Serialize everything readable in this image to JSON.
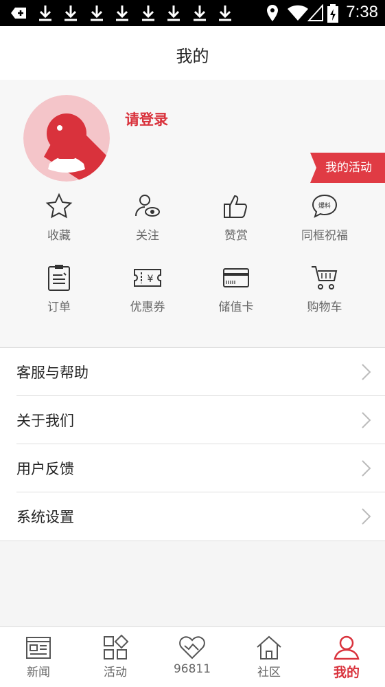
{
  "status_bar": {
    "time": "7:38",
    "icons": [
      "notification-plus-icon",
      "download-icon",
      "download-icon",
      "download-icon",
      "download-icon",
      "download-icon",
      "download-icon",
      "download-icon",
      "download-icon",
      "location-icon",
      "wifi-icon",
      "signal-icon",
      "battery-charging-icon"
    ]
  },
  "header": {
    "title": "我的"
  },
  "profile": {
    "login_label": "请登录",
    "activity_tag": "我的活动"
  },
  "shortcuts": [
    {
      "label": "收藏",
      "icon": "star-icon"
    },
    {
      "label": "关注",
      "icon": "follow-user-icon"
    },
    {
      "label": "赞赏",
      "icon": "thumbs-up-icon"
    },
    {
      "label": "同框祝福",
      "icon": "chat-bubble-icon",
      "badge": "爆料"
    },
    {
      "label": "订单",
      "icon": "clipboard-icon"
    },
    {
      "label": "优惠券",
      "icon": "coupon-icon",
      "badge": "¥"
    },
    {
      "label": "储值卡",
      "icon": "card-icon"
    },
    {
      "label": "购物车",
      "icon": "cart-icon"
    }
  ],
  "menu": [
    {
      "label": "客服与帮助"
    },
    {
      "label": "关于我们"
    },
    {
      "label": "用户反馈"
    },
    {
      "label": "系统设置"
    }
  ],
  "tabbar": [
    {
      "label": "新闻",
      "icon": "news-icon"
    },
    {
      "label": "活动",
      "icon": "apps-icon"
    },
    {
      "label": "96811",
      "icon": "heart-icon"
    },
    {
      "label": "社区",
      "icon": "home-icon"
    },
    {
      "label": "我的",
      "icon": "person-icon",
      "active": true
    }
  ],
  "colors": {
    "accent": "#d9323c",
    "avatar_bg": "#f4c5c9"
  }
}
